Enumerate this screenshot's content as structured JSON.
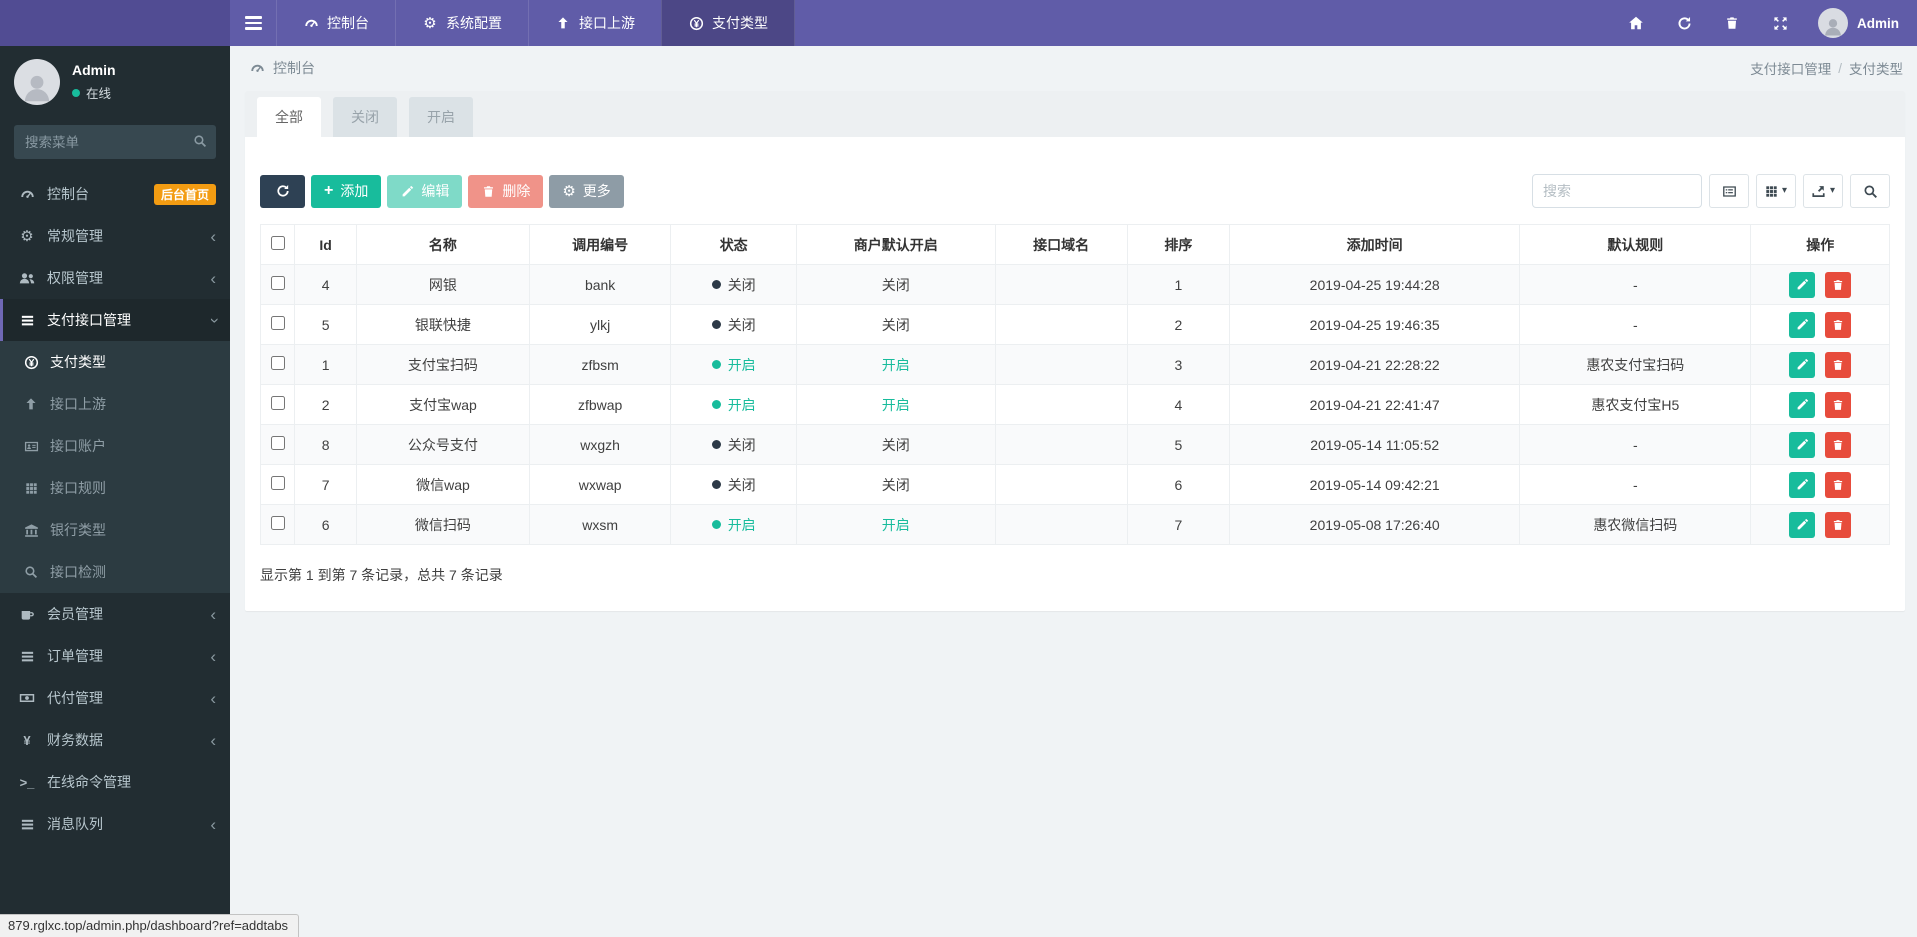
{
  "colors": {
    "accent": "#605ca8",
    "green": "#18bc9c",
    "red": "#e74c3c",
    "orange": "#f39c12",
    "dark": "#2e4154",
    "sidebar": "#222d32"
  },
  "icons": {
    "gear": "⚙",
    "caret": "▾",
    "chevron": "‹",
    "yen": "¥",
    "terminal": ">_",
    "slash": "/",
    "plus": "+"
  },
  "navbar": {
    "tabs": [
      {
        "label": "控制台"
      },
      {
        "label": "系统配置"
      },
      {
        "label": "接口上游"
      },
      {
        "label": "支付类型"
      }
    ],
    "user_label": "Admin"
  },
  "sidebar": {
    "user": {
      "name": "Admin",
      "status": "在线"
    },
    "search_placeholder": "搜索菜单",
    "menu": [
      {
        "label": "控制台",
        "badge": "后台首页"
      },
      {
        "label": "常规管理"
      },
      {
        "label": "权限管理"
      },
      {
        "label": "支付接口管理",
        "children": [
          "支付类型",
          "接口上游",
          "接口账户",
          "接口规则",
          "银行类型",
          "接口检测"
        ]
      },
      {
        "label": "会员管理"
      },
      {
        "label": "订单管理"
      },
      {
        "label": "代付管理"
      },
      {
        "label": "财务数据"
      },
      {
        "label": "在线命令管理"
      },
      {
        "label": "消息队列"
      }
    ]
  },
  "content": {
    "header": {
      "title": "控制台",
      "breadcrumb": [
        "支付接口管理",
        "支付类型"
      ]
    },
    "tabs": [
      "全部",
      "关闭",
      "开启"
    ],
    "toolbar": {
      "add": "添加",
      "edit": "编辑",
      "delete": "删除",
      "more": "更多",
      "search_placeholder": "搜索"
    },
    "table": {
      "columns": [
        "Id",
        "名称",
        "调用编号",
        "状态",
        "商户默认开启",
        "接口域名",
        "排序",
        "添加时间",
        "默认规则",
        "操作"
      ],
      "rows": [
        {
          "id": "4",
          "name": "网银",
          "code": "bank",
          "status": "关闭",
          "merchant": "关闭",
          "domain": "",
          "sort": "1",
          "time": "2019-04-25 19:44:28",
          "rule": "-"
        },
        {
          "id": "5",
          "name": "银联快捷",
          "code": "ylkj",
          "status": "关闭",
          "merchant": "关闭",
          "domain": "",
          "sort": "2",
          "time": "2019-04-25 19:46:35",
          "rule": "-"
        },
        {
          "id": "1",
          "name": "支付宝扫码",
          "code": "zfbsm",
          "status": "开启",
          "merchant": "开启",
          "domain": "",
          "sort": "3",
          "time": "2019-04-21 22:28:22",
          "rule": "惠农支付宝扫码"
        },
        {
          "id": "2",
          "name": "支付宝wap",
          "code": "zfbwap",
          "status": "开启",
          "merchant": "开启",
          "domain": "",
          "sort": "4",
          "time": "2019-04-21 22:41:47",
          "rule": "惠农支付宝H5"
        },
        {
          "id": "8",
          "name": "公众号支付",
          "code": "wxgzh",
          "status": "关闭",
          "merchant": "关闭",
          "domain": "",
          "sort": "5",
          "time": "2019-05-14 11:05:52",
          "rule": "-"
        },
        {
          "id": "7",
          "name": "微信wap",
          "code": "wxwap",
          "status": "关闭",
          "merchant": "关闭",
          "domain": "",
          "sort": "6",
          "time": "2019-05-14 09:42:21",
          "rule": "-"
        },
        {
          "id": "6",
          "name": "微信扫码",
          "code": "wxsm",
          "status": "开启",
          "merchant": "开启",
          "domain": "",
          "sort": "7",
          "time": "2019-05-08 17:26:40",
          "rule": "惠农微信扫码"
        }
      ],
      "summary": "显示第 1 到第 7 条记录，总共 7 条记录"
    }
  },
  "statusbar": {
    "url": "879.rglxc.top/admin.php/dashboard?ref=addtabs"
  }
}
